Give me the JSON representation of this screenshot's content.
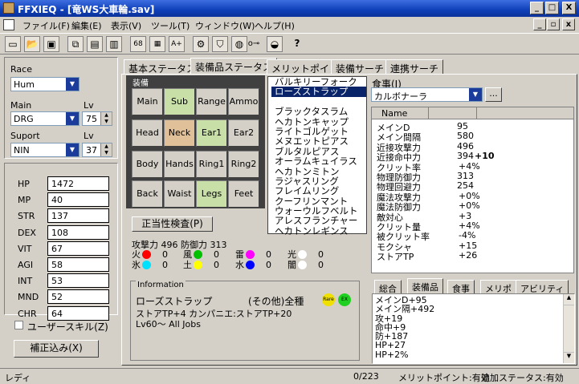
{
  "window": {
    "title": "FFXIEQ - [竜WS大車輪.sav]",
    "min": "_",
    "max": "□",
    "close": "X",
    "inner_min": "_",
    "inner_max": "▫",
    "inner_close": "x"
  },
  "menu": [
    "ファイル(F)",
    "編集(E)",
    "表示(V)",
    "ツール(T)",
    "ウィンドウ(W)",
    "ヘルプ(H)"
  ],
  "left": {
    "race_label": "Race",
    "race": "Hum",
    "main_label": "Main",
    "main": "DRG",
    "lv_label": "Lv",
    "main_lv": "75",
    "sup_label": "Suport",
    "sup": "NIN",
    "sup_lv_label": "Lv",
    "sup_lv": "37",
    "stats": [
      {
        "k": "HP",
        "v": "1472"
      },
      {
        "k": "MP",
        "v": "40"
      },
      {
        "k": "STR",
        "v": "137"
      },
      {
        "k": "DEX",
        "v": "108"
      },
      {
        "k": "VIT",
        "v": "67"
      },
      {
        "k": "AGI",
        "v": "58"
      },
      {
        "k": "INT",
        "v": "53"
      },
      {
        "k": "MND",
        "v": "52"
      },
      {
        "k": "CHR",
        "v": "64"
      }
    ],
    "user_skill": "ユーザースキル(Z)",
    "correct_btn": "補正込み(X)"
  },
  "tabs": [
    "基本ステータス",
    "装備品ステータス",
    "メリットポイント",
    "装備サーチ",
    "連携サーチ"
  ],
  "equip": {
    "group": "装備",
    "slots": [
      "Main",
      "Sub",
      "Range",
      "Ammo",
      "Head",
      "Neck",
      "Ear1",
      "Ear2",
      "Body",
      "Hands",
      "Ring1",
      "Ring2",
      "Back",
      "Waist",
      "Legs",
      "Feet"
    ],
    "validate_btn": "正当性検査(P)",
    "atk_def": "攻撃力 496 防御力 313",
    "elements": [
      {
        "n": "火",
        "v": "0",
        "c": "#ff0000"
      },
      {
        "n": "風",
        "v": "0",
        "c": "#00c000"
      },
      {
        "n": "雷",
        "v": "0",
        "c": "#ff00ff"
      },
      {
        "n": "光",
        "v": "0",
        "c": "#ffffff"
      },
      {
        "n": "氷",
        "v": "0",
        "c": "#00e0ff"
      },
      {
        "n": "土",
        "v": "0",
        "c": "#ffff00"
      },
      {
        "n": "水",
        "v": "0",
        "c": "#0000ff"
      },
      {
        "n": "闇",
        "v": "0",
        "c": "#ffffff"
      }
    ]
  },
  "info": {
    "label": "Information",
    "name": "ローズストラップ",
    "type": "(その他)全種",
    "badge1": "Rare",
    "badge2": "EX",
    "line2": "ストアTP+4 カンパニエ:ストアTP+20",
    "line3": "Lv60～ All Jobs"
  },
  "itemlist": [
    "バルキリーフォーク",
    "ローズストラップ",
    "",
    "ブラックタスラム",
    "ヘカトンキャップ",
    "ライトゴルゲット",
    "メヌエットピアス",
    "ブルタルピアス",
    "オーラムキュイラス",
    "ヘカトンミトン",
    "ラジャスリング",
    "フレイムリング",
    "クーフリンマント",
    "ウォーウルフベルト",
    "アレスフランチャー",
    "ヘカトンレギンス"
  ],
  "food": {
    "label": "食事(J)",
    "value": "カルボナーラ",
    "btn": "..."
  },
  "table": {
    "col": "Name",
    "rows": [
      {
        "k": "メインD",
        "v": "95",
        "b": ""
      },
      {
        "k": "メイン間隔",
        "v": "580",
        "b": ""
      },
      {
        "k": "近接攻撃力",
        "v": "496",
        "b": ""
      },
      {
        "k": "近接命中力",
        "v": "394",
        "b": "+10"
      },
      {
        "k": "クリット率",
        "v": "+4%",
        "b": ""
      },
      {
        "k": "物理防御力",
        "v": "313",
        "b": ""
      },
      {
        "k": "物理回避力",
        "v": "254",
        "b": ""
      },
      {
        "k": "魔法攻撃力",
        "v": "+0%",
        "b": ""
      },
      {
        "k": "魔法防御力",
        "v": "+0%",
        "b": ""
      },
      {
        "k": "敵対心",
        "v": "+3",
        "b": ""
      },
      {
        "k": "クリット量",
        "v": "+4%",
        "b": ""
      },
      {
        "k": "被クリット率",
        "v": "-4%",
        "b": ""
      },
      {
        "k": "モクシャ",
        "v": "+15",
        "b": ""
      },
      {
        "k": "ストアTP",
        "v": "+26",
        "b": ""
      }
    ]
  },
  "btabs": [
    "総合",
    "装備品",
    "食事",
    "メリポ",
    "アビリティ"
  ],
  "bottom_text": [
    "メインD+95",
    "メイン隔+492",
    "攻+19",
    "命中+9",
    "防+187",
    "HP+27",
    "HP+2%"
  ],
  "status": {
    "ready": "レディ",
    "count": "0/223",
    "merit": "メリットポイント:有効",
    "extra": "追加ステータス:有効"
  }
}
